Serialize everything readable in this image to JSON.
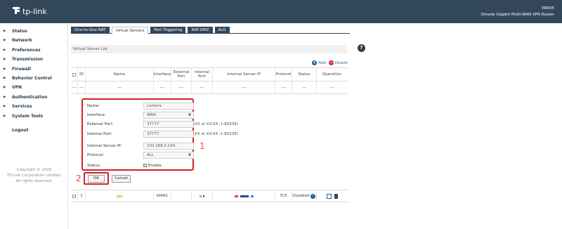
{
  "header": {
    "brand": "tp-link",
    "model": "ER605",
    "device": "Omada Gigabit Multi-WAN VPN Router"
  },
  "sidebar": {
    "items": [
      {
        "label": "Status"
      },
      {
        "label": "Network"
      },
      {
        "label": "Preferences"
      },
      {
        "label": "Transmission"
      },
      {
        "label": "Firewall"
      },
      {
        "label": "Behavior Control"
      },
      {
        "label": "VPN"
      },
      {
        "label": "Authentication"
      },
      {
        "label": "Services"
      },
      {
        "label": "System Tools"
      }
    ],
    "logout": "Logout",
    "copyright": [
      "Copyright © 2020",
      "TP-Link Corporation Limited.",
      "All rights reserved."
    ]
  },
  "tabs": [
    {
      "label": "One-to-One NAT",
      "active": false
    },
    {
      "label": "Virtual Servers",
      "active": true
    },
    {
      "label": "Port Triggering",
      "active": false
    },
    {
      "label": "NAT-DMZ",
      "active": false
    },
    {
      "label": "ALG",
      "active": false
    }
  ],
  "section_title": "Virtual Server List",
  "help_icon": "?",
  "actions": {
    "add": "Add",
    "delete": "Delete"
  },
  "table": {
    "headers": {
      "id": "ID",
      "name": "Name",
      "interface": "Interface",
      "external_port": "External Port",
      "internal_port": "Internal Port",
      "internal_ip": "Internal Server IP",
      "protocol": "Protocol",
      "status": "Status",
      "operation": "Operation"
    },
    "empty_cell": "---",
    "row": {
      "id": "1",
      "interface": "WAN1",
      "protocol": "TCP",
      "status": "Disabled"
    }
  },
  "form": {
    "name_label": "Name:",
    "name_value": "camera",
    "interface_label": "Interface:",
    "interface_value": "WAN",
    "ext_port_label": "External Port:",
    "ext_port_value": "37777",
    "int_port_label": "Internal Port:",
    "int_port_value": "37777",
    "ip_label": "Internal Server IP:",
    "ip_value": "192.168.0.144",
    "protocol_label": "Protocol:",
    "protocol_value": "ALL",
    "status_label": "Status:",
    "status_value": "Enable",
    "port_hint": "(XX or XX-XX ,1-65535)"
  },
  "buttons": {
    "ok": "OK",
    "cancel": "Cancel"
  },
  "annotations": {
    "one": "1",
    "two": "2"
  },
  "colors": {
    "header_bg": "#33475a",
    "accent": "#1d5e92",
    "highlight": "#d62026",
    "annotation": "#e2522b"
  }
}
